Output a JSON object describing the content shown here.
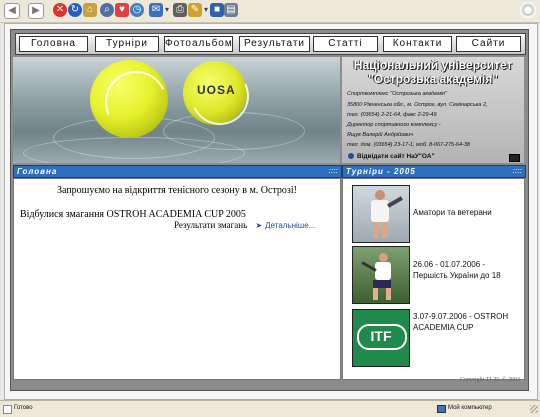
{
  "nav": [
    "Головна",
    "Турніри",
    "Фотоальбом",
    "Результати",
    "Статті",
    "Контакти",
    "Сайти"
  ],
  "hero": {
    "ball_text": "UOSA"
  },
  "info": {
    "title_line1": "Національний університет",
    "title_line2": "\"Острозька академія\"",
    "lines": [
      "Спорткомплекс \"Острозька академія\"",
      "35800 Рівненська обл., м. Острог, вул. Семінарська 2,",
      "тел. (03654) 2-21-64, факс 2-29-49",
      "Директор спортивного комплексу -",
      "Ящук Валерій Андрійович",
      "тел. дом. (03654) 23-17-1, моб. 8-067-275-64-38"
    ],
    "link": "Відвідати сайт НаУ\"ОА\""
  },
  "main": {
    "header": "Головна",
    "welcome": "Запрошуємо на відкриття тенісного сезону в м. Острозі!",
    "news": "Відбулися змагання OSTROH ACADEMIA CUP 2005",
    "results_label": "Результати змагань",
    "more": "Детальніше..."
  },
  "side": {
    "header": "Турніри - 2005",
    "tournaments": [
      {
        "text": "Аматори та ветерани"
      },
      {
        "text": "26.06 - 01.07.2006 - Першість України до 18"
      },
      {
        "text": "3.07-9.07.2006 - OSTROH ACADEMIA CUP"
      }
    ],
    "itf_logo": "ITF"
  },
  "copyright": "Copyright  TI-ZL  ©  2004",
  "status": {
    "left": "Готово",
    "right": "Мой компьютер"
  }
}
